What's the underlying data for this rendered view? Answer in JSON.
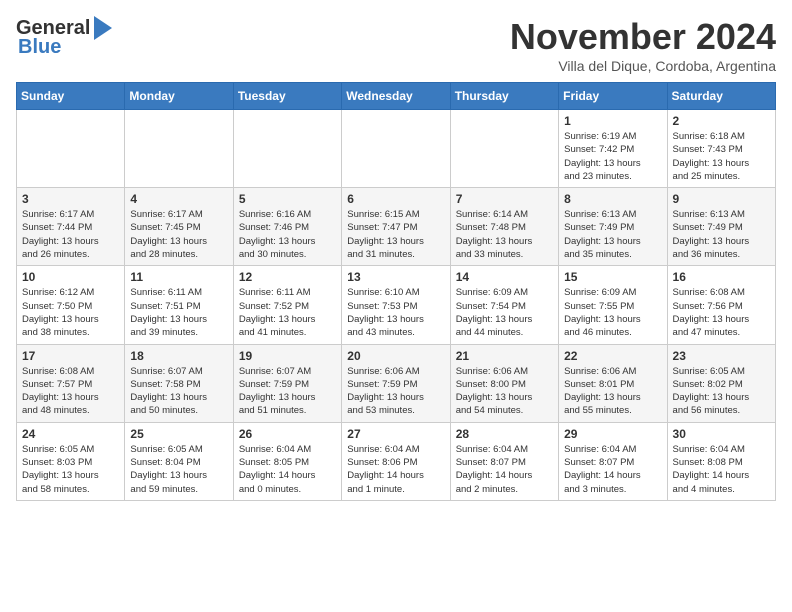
{
  "header": {
    "logo_line1": "General",
    "logo_line2": "Blue",
    "month_title": "November 2024",
    "subtitle": "Villa del Dique, Cordoba, Argentina"
  },
  "calendar": {
    "days_of_week": [
      "Sunday",
      "Monday",
      "Tuesday",
      "Wednesday",
      "Thursday",
      "Friday",
      "Saturday"
    ],
    "weeks": [
      [
        {
          "day": "",
          "info": ""
        },
        {
          "day": "",
          "info": ""
        },
        {
          "day": "",
          "info": ""
        },
        {
          "day": "",
          "info": ""
        },
        {
          "day": "",
          "info": ""
        },
        {
          "day": "1",
          "info": "Sunrise: 6:19 AM\nSunset: 7:42 PM\nDaylight: 13 hours\nand 23 minutes."
        },
        {
          "day": "2",
          "info": "Sunrise: 6:18 AM\nSunset: 7:43 PM\nDaylight: 13 hours\nand 25 minutes."
        }
      ],
      [
        {
          "day": "3",
          "info": "Sunrise: 6:17 AM\nSunset: 7:44 PM\nDaylight: 13 hours\nand 26 minutes."
        },
        {
          "day": "4",
          "info": "Sunrise: 6:17 AM\nSunset: 7:45 PM\nDaylight: 13 hours\nand 28 minutes."
        },
        {
          "day": "5",
          "info": "Sunrise: 6:16 AM\nSunset: 7:46 PM\nDaylight: 13 hours\nand 30 minutes."
        },
        {
          "day": "6",
          "info": "Sunrise: 6:15 AM\nSunset: 7:47 PM\nDaylight: 13 hours\nand 31 minutes."
        },
        {
          "day": "7",
          "info": "Sunrise: 6:14 AM\nSunset: 7:48 PM\nDaylight: 13 hours\nand 33 minutes."
        },
        {
          "day": "8",
          "info": "Sunrise: 6:13 AM\nSunset: 7:49 PM\nDaylight: 13 hours\nand 35 minutes."
        },
        {
          "day": "9",
          "info": "Sunrise: 6:13 AM\nSunset: 7:49 PM\nDaylight: 13 hours\nand 36 minutes."
        }
      ],
      [
        {
          "day": "10",
          "info": "Sunrise: 6:12 AM\nSunset: 7:50 PM\nDaylight: 13 hours\nand 38 minutes."
        },
        {
          "day": "11",
          "info": "Sunrise: 6:11 AM\nSunset: 7:51 PM\nDaylight: 13 hours\nand 39 minutes."
        },
        {
          "day": "12",
          "info": "Sunrise: 6:11 AM\nSunset: 7:52 PM\nDaylight: 13 hours\nand 41 minutes."
        },
        {
          "day": "13",
          "info": "Sunrise: 6:10 AM\nSunset: 7:53 PM\nDaylight: 13 hours\nand 43 minutes."
        },
        {
          "day": "14",
          "info": "Sunrise: 6:09 AM\nSunset: 7:54 PM\nDaylight: 13 hours\nand 44 minutes."
        },
        {
          "day": "15",
          "info": "Sunrise: 6:09 AM\nSunset: 7:55 PM\nDaylight: 13 hours\nand 46 minutes."
        },
        {
          "day": "16",
          "info": "Sunrise: 6:08 AM\nSunset: 7:56 PM\nDaylight: 13 hours\nand 47 minutes."
        }
      ],
      [
        {
          "day": "17",
          "info": "Sunrise: 6:08 AM\nSunset: 7:57 PM\nDaylight: 13 hours\nand 48 minutes."
        },
        {
          "day": "18",
          "info": "Sunrise: 6:07 AM\nSunset: 7:58 PM\nDaylight: 13 hours\nand 50 minutes."
        },
        {
          "day": "19",
          "info": "Sunrise: 6:07 AM\nSunset: 7:59 PM\nDaylight: 13 hours\nand 51 minutes."
        },
        {
          "day": "20",
          "info": "Sunrise: 6:06 AM\nSunset: 7:59 PM\nDaylight: 13 hours\nand 53 minutes."
        },
        {
          "day": "21",
          "info": "Sunrise: 6:06 AM\nSunset: 8:00 PM\nDaylight: 13 hours\nand 54 minutes."
        },
        {
          "day": "22",
          "info": "Sunrise: 6:06 AM\nSunset: 8:01 PM\nDaylight: 13 hours\nand 55 minutes."
        },
        {
          "day": "23",
          "info": "Sunrise: 6:05 AM\nSunset: 8:02 PM\nDaylight: 13 hours\nand 56 minutes."
        }
      ],
      [
        {
          "day": "24",
          "info": "Sunrise: 6:05 AM\nSunset: 8:03 PM\nDaylight: 13 hours\nand 58 minutes."
        },
        {
          "day": "25",
          "info": "Sunrise: 6:05 AM\nSunset: 8:04 PM\nDaylight: 13 hours\nand 59 minutes."
        },
        {
          "day": "26",
          "info": "Sunrise: 6:04 AM\nSunset: 8:05 PM\nDaylight: 14 hours\nand 0 minutes."
        },
        {
          "day": "27",
          "info": "Sunrise: 6:04 AM\nSunset: 8:06 PM\nDaylight: 14 hours\nand 1 minute."
        },
        {
          "day": "28",
          "info": "Sunrise: 6:04 AM\nSunset: 8:07 PM\nDaylight: 14 hours\nand 2 minutes."
        },
        {
          "day": "29",
          "info": "Sunrise: 6:04 AM\nSunset: 8:07 PM\nDaylight: 14 hours\nand 3 minutes."
        },
        {
          "day": "30",
          "info": "Sunrise: 6:04 AM\nSunset: 8:08 PM\nDaylight: 14 hours\nand 4 minutes."
        }
      ]
    ]
  }
}
